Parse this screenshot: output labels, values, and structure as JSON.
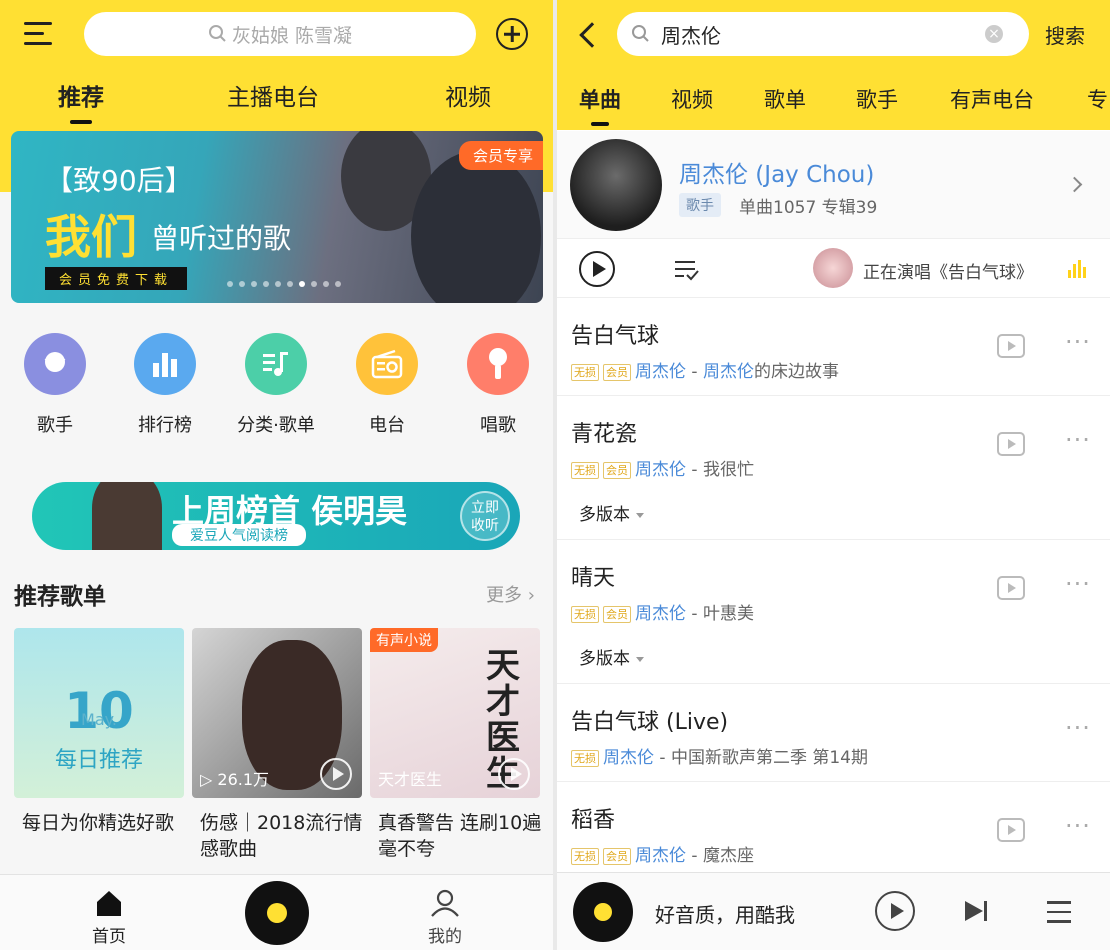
{
  "left": {
    "search": {
      "placeholder": "灰姑娘 陈雪凝"
    },
    "tabs": [
      "推荐",
      "主播电台",
      "视频"
    ],
    "banner": {
      "line1": "【致90后】",
      "line2": "我们",
      "line3": "曾听过的歌",
      "line4": "会员免费下载",
      "badge": "会员专享"
    },
    "quick": [
      {
        "label": "歌手",
        "icon": "singer-icon",
        "color": "#8a8fe0"
      },
      {
        "label": "排行榜",
        "icon": "chart-icon",
        "color": "#5aa9ef"
      },
      {
        "label": "分类·歌单",
        "icon": "playlist-icon",
        "color": "#4ccfa8"
      },
      {
        "label": "电台",
        "icon": "radio-icon",
        "color": "#ffc23a"
      },
      {
        "label": "唱歌",
        "icon": "mic-icon",
        "color": "#ff7e6a"
      }
    ],
    "ad": {
      "title": "上周榜首 侯明昊",
      "sub": "爱豆人气阅读榜",
      "cta_line1": "立即",
      "cta_line2": "收听"
    },
    "section": {
      "title": "推荐歌单",
      "more": "更多"
    },
    "cards": [
      {
        "art_day": "10",
        "art_month": "May.",
        "art_label": "每日推荐",
        "caption": "每日为你精选好歌"
      },
      {
        "plays": "▷ 26.1万",
        "caption": "伤感｜2018流行情感歌曲"
      },
      {
        "tag": "有声小说",
        "art_title": "天才医生",
        "art_label": "天才医生",
        "caption": "真香警告 连刷10遍毫不夸"
      }
    ],
    "nav": {
      "home": "首页",
      "me": "我的"
    }
  },
  "right": {
    "search": {
      "value": "周杰伦",
      "go": "搜索"
    },
    "tabs": [
      "单曲",
      "视频",
      "歌单",
      "歌手",
      "有声电台",
      "专"
    ],
    "artist": {
      "name": "周杰伦 (Jay Chou)",
      "badge": "歌手",
      "stats": "单曲1057 专辑39"
    },
    "now_playing": "正在演唱《告白气球》",
    "songs": [
      {
        "title": "告白气球",
        "tags": [
          "无损",
          "会员"
        ],
        "artist": "周杰伦",
        "sep": " - ",
        "album_blue": "周杰伦",
        "album": "的床边故事"
      },
      {
        "title": "青花瓷",
        "tags": [
          "无损",
          "会员"
        ],
        "artist": "周杰伦",
        "sep": " - ",
        "album_blue": "",
        "album": "我很忙",
        "versions": "多版本"
      },
      {
        "title": "晴天",
        "tags": [
          "无损",
          "会员"
        ],
        "artist": "周杰伦",
        "sep": " - ",
        "album_blue": "",
        "album": "叶惠美",
        "versions": "多版本"
      },
      {
        "title": "告白气球 (Live)",
        "tags": [
          "无损"
        ],
        "artist": "周杰伦",
        "sep": " - ",
        "album_blue": "",
        "album": "中国新歌声第二季 第14期"
      },
      {
        "title": "稻香",
        "tags": [
          "无损",
          "会员"
        ],
        "artist": "周杰伦",
        "sep": " - ",
        "album_blue": "",
        "album": "魔杰座"
      }
    ],
    "mini_player": {
      "text": "好音质，用酷我"
    }
  },
  "colors": {
    "brand_yellow": "#ffe033",
    "link_blue": "#4a8ad8",
    "vip_orange": "#ff6a28"
  }
}
